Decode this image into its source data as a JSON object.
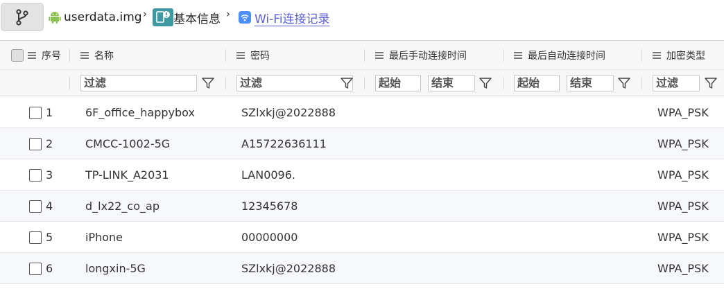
{
  "breadcrumb": {
    "file": "userdata.img",
    "section": "基本信息",
    "current": "Wi-Fi连接记录"
  },
  "icons": {
    "branch": "branch-icon",
    "android": "android-icon",
    "info": "info-doc-icon",
    "wifi": "wifi-icon",
    "menu": "menu-icon",
    "filter": "filter-funnel-icon"
  },
  "colors": {
    "android_green": "#8bc34a",
    "info_teal": "#3e9aa0",
    "wifi_blue": "#4d8ef7",
    "link_purple": "#5b5fd6"
  },
  "table": {
    "columns": [
      "序号",
      "名称",
      "密码",
      "最后手动连接时间",
      "最后自动连接时间",
      "加密类型"
    ],
    "filters": {
      "text_placeholder": "过滤",
      "start_placeholder": "起始",
      "end_placeholder": "结束"
    },
    "rows": [
      {
        "index": "1",
        "name": "6F_office_happybox",
        "password": "SZlxkj@2022888",
        "manual_time": "",
        "auto_time": "",
        "encryption": "WPA_PSK"
      },
      {
        "index": "2",
        "name": "CMCC-1002-5G",
        "password": "A15722636111",
        "manual_time": "",
        "auto_time": "",
        "encryption": "WPA_PSK"
      },
      {
        "index": "3",
        "name": "TP-LINK_A2031",
        "password": "LAN0096.",
        "manual_time": "",
        "auto_time": "",
        "encryption": "WPA_PSK"
      },
      {
        "index": "4",
        "name": "d_lx22_co_ap",
        "password": "12345678",
        "manual_time": "",
        "auto_time": "",
        "encryption": "WPA_PSK"
      },
      {
        "index": "5",
        "name": "iPhone",
        "password": "00000000",
        "manual_time": "",
        "auto_time": "",
        "encryption": "WPA_PSK"
      },
      {
        "index": "6",
        "name": "longxin-5G",
        "password": "SZlxkj@2022888",
        "manual_time": "",
        "auto_time": "",
        "encryption": "WPA_PSK"
      }
    ]
  }
}
